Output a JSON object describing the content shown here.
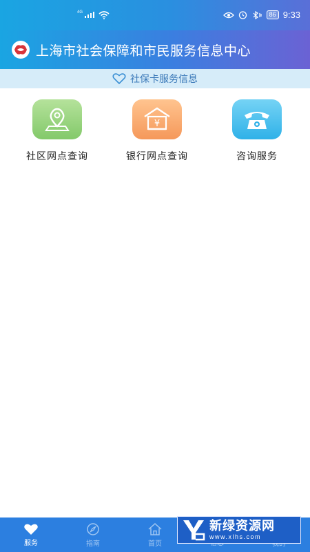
{
  "status_bar": {
    "network": "4G",
    "battery": "86",
    "time": "9:33"
  },
  "header": {
    "title": "上海市社会保障和市民服务信息中心"
  },
  "subheader": {
    "title": "社保卡服务信息"
  },
  "services": [
    {
      "label": "社区网点查询",
      "icon": "map-pin-icon",
      "color": "#8fce74"
    },
    {
      "label": "银行网点查询",
      "icon": "bank-building-icon",
      "color": "#f7a567"
    },
    {
      "label": "咨询服务",
      "icon": "telephone-icon",
      "color": "#3db7ea"
    }
  ],
  "tabbar": {
    "items": [
      {
        "label": "服务",
        "icon": "heart-icon",
        "active": true
      },
      {
        "label": "指南",
        "icon": "compass-icon",
        "active": false
      },
      {
        "label": "首页",
        "icon": "home-icon",
        "active": false
      },
      {
        "label": "信息",
        "icon": "message-icon",
        "active": false
      },
      {
        "label": "我的",
        "icon": "user-icon",
        "active": false
      }
    ]
  },
  "watermark": {
    "title": "新绿资源网",
    "url": "www.xlhs.com"
  },
  "colors": {
    "primary": "#2c7fe0",
    "accent": "#1aa5e2",
    "subheader_bg": "#d6ecf9"
  }
}
